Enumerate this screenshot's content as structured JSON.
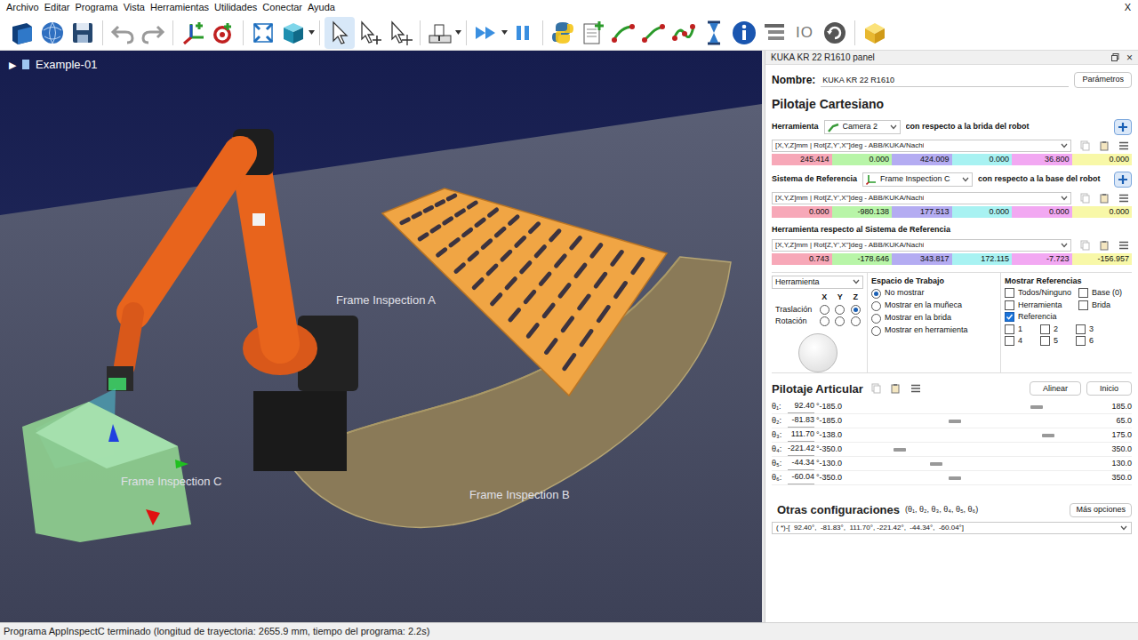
{
  "menu": [
    "Archivo",
    "Editar",
    "Programa",
    "Vista",
    "Herramientas",
    "Utilidades",
    "Conectar",
    "Ayuda"
  ],
  "window_close": "X",
  "toolbar": {
    "io_label": "IO"
  },
  "scene": {
    "tree_root": {
      "toggle": "▶",
      "label": "Example-01",
      "expanded": false
    },
    "labels": [
      "Frame Inspection A",
      "Frame Inspection B",
      "Frame Inspection C"
    ]
  },
  "panel": {
    "title": "KUKA KR 22 R1610 panel",
    "close": "×",
    "name_label": "Nombre:",
    "name_value": "KUKA KR 22 R1610",
    "params_button": "Parámetros",
    "cartesian": {
      "heading": "Pilotaje Cartesiano",
      "tool": {
        "label": "Herramienta",
        "value": "Camera 2",
        "suffix": "con respecto a la brida del robot",
        "format": "[X,Y,Z]mm | Rot[Z,Y',X'']deg - ABB/KUKA/Nachi",
        "values": [
          {
            "value": "245.414",
            "color": "#f7a8b8"
          },
          {
            "value": "0.000",
            "color": "#b8f5a8"
          },
          {
            "value": "424.009",
            "color": "#b4acf2"
          },
          {
            "value": "0.000",
            "color": "#a8f2f2"
          },
          {
            "value": "36.800",
            "color": "#f2a8f2"
          },
          {
            "value": "0.000",
            "color": "#f8f8a8"
          }
        ]
      },
      "reference": {
        "label": "Sistema de Referencia",
        "value": "Frame Inspection C",
        "suffix": "con respecto a la base del robot",
        "format": "[X,Y,Z]mm | Rot[Z,Y',X'']deg - ABB/KUKA/Nachi",
        "values": [
          {
            "value": "0.000",
            "color": "#f7a8b8"
          },
          {
            "value": "-980.138",
            "color": "#b8f5a8"
          },
          {
            "value": "177.513",
            "color": "#b4acf2"
          },
          {
            "value": "0.000",
            "color": "#a8f2f2"
          },
          {
            "value": "0.000",
            "color": "#f2a8f2"
          },
          {
            "value": "0.000",
            "color": "#f8f8a8"
          }
        ]
      },
      "relative": {
        "label": "Herramienta respecto al Sistema de Referencia",
        "format": "[X,Y,Z]mm | Rot[Z,Y',X'']deg - ABB/KUKA/Nachi",
        "values": [
          {
            "value": "0.743",
            "color": "#f7a8b8"
          },
          {
            "value": "-178.646",
            "color": "#b8f5a8"
          },
          {
            "value": "343.817",
            "color": "#b4acf2"
          },
          {
            "value": "172.115",
            "color": "#a8f2f2"
          },
          {
            "value": "-7.723",
            "color": "#f2a8f2"
          },
          {
            "value": "-156.957",
            "color": "#f8f8a8"
          }
        ]
      }
    },
    "jog": {
      "mode": "Herramienta",
      "axes": [
        "X",
        "Y",
        "Z"
      ],
      "rows": [
        {
          "label": "Traslación",
          "selected": [
            false,
            false,
            true
          ]
        },
        {
          "label": "Rotación",
          "selected": [
            false,
            false,
            false
          ]
        }
      ]
    },
    "workspace": {
      "title": "Espacio de Trabajo",
      "options": [
        {
          "label": "No mostrar",
          "selected": true
        },
        {
          "label": "Mostrar en la muñeca",
          "selected": false
        },
        {
          "label": "Mostrar en la brida",
          "selected": false
        },
        {
          "label": "Mostrar en herramienta",
          "selected": false
        }
      ]
    },
    "references": {
      "title": "Mostrar Referencias",
      "items": [
        {
          "label": "Todos/Ninguno",
          "checked": false
        },
        {
          "label": "Base (0)",
          "checked": false
        },
        {
          "label": "Herramienta",
          "checked": false
        },
        {
          "label": "Brida",
          "checked": false
        },
        {
          "label": "Referencia",
          "checked": true
        }
      ],
      "numbered": [
        {
          "label": "1",
          "checked": false
        },
        {
          "label": "2",
          "checked": false
        },
        {
          "label": "3",
          "checked": false
        },
        {
          "label": "4",
          "checked": false
        },
        {
          "label": "5",
          "checked": false
        },
        {
          "label": "6",
          "checked": false
        }
      ]
    },
    "joints": {
      "heading": "Pilotaje Articular",
      "align_button": "Alinear",
      "home_button": "Inicio",
      "unit": "°",
      "rows": [
        {
          "label": "θ₁:",
          "value": "92.40",
          "min": "-185.0",
          "max": "185.0",
          "level": 0.75
        },
        {
          "label": "θ₂:",
          "value": "-81.83",
          "min": "-185.0",
          "max": "65.0",
          "level": 0.41
        },
        {
          "label": "θ₃:",
          "value": "111.70",
          "min": "-138.0",
          "max": "175.0",
          "level": 0.8
        },
        {
          "label": "θ₄:",
          "value": "-221.42",
          "min": "-350.0",
          "max": "350.0",
          "level": 0.18
        },
        {
          "label": "θ₅:",
          "value": "-44.34",
          "min": "-130.0",
          "max": "130.0",
          "level": 0.33
        },
        {
          "label": "θ₆:",
          "value": "-60.04",
          "min": "-350.0",
          "max": "350.0",
          "level": 0.41
        }
      ]
    },
    "configs": {
      "heading": "Otras configuraciones",
      "subheading": "(θ₁, θ₂, θ₃, θ₄, θ₅, θ₆)",
      "button": "Más opciones",
      "value": "( *)-[  92.40°,  -81.83°,  111.70°, -221.42°,  -44.34°,  -60.04°]"
    }
  },
  "status_bar": "Programa AppInspectC terminado (longitud de trayectoria: 2655.9 mm, tiempo del programa: 2.2s)"
}
